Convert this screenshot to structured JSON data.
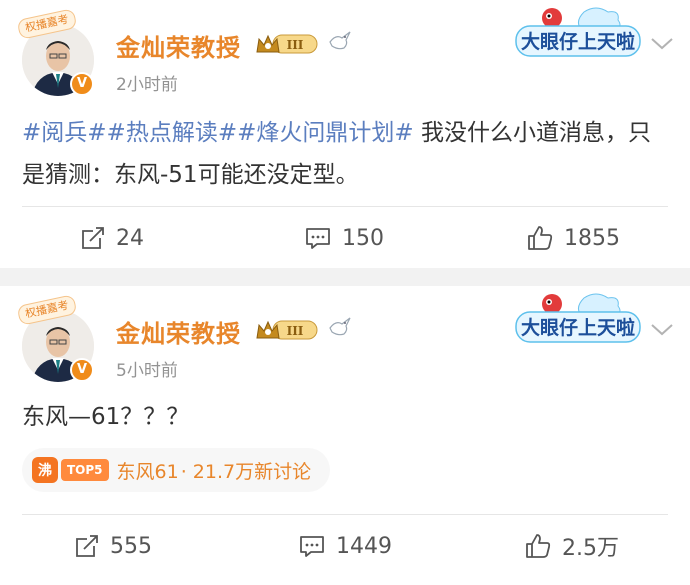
{
  "posts": [
    {
      "author": "金灿荣教授",
      "badge_sticker": "权播嘉考",
      "level": "III",
      "time": "2小时前",
      "content_tags": "#阅兵##热点解读##烽火问鼎计划#",
      "content_text": " 我没什么小道消息，只是猜测：东风-51可能还没定型。",
      "sticker_text": "大眼仔上天啦",
      "actions": {
        "repost": "24",
        "comment": "150",
        "like": "1855"
      }
    },
    {
      "author": "金灿荣教授",
      "badge_sticker": "权播嘉考",
      "level": "III",
      "time": "5小时前",
      "content_text": "东风—61？？？",
      "topic": {
        "hot_icon": "沸",
        "rank": "TOP5",
        "name": "东风61",
        "stats": "· 21.7万新讨论"
      },
      "sticker_text": "大眼仔上天啦",
      "actions": {
        "repost": "555",
        "comment": "1449",
        "like": "2.5万"
      }
    }
  ],
  "icons": {
    "repost": "repost-icon",
    "comment": "comment-icon",
    "like": "like-icon",
    "more": "chevron-down-icon",
    "verified": "verified-v-icon",
    "bird": "dove-icon"
  },
  "colors": {
    "author": "#e8862b",
    "tag": "#5b7ebf",
    "text": "#333333",
    "meta": "#939393",
    "verified": "#f08c1a"
  }
}
